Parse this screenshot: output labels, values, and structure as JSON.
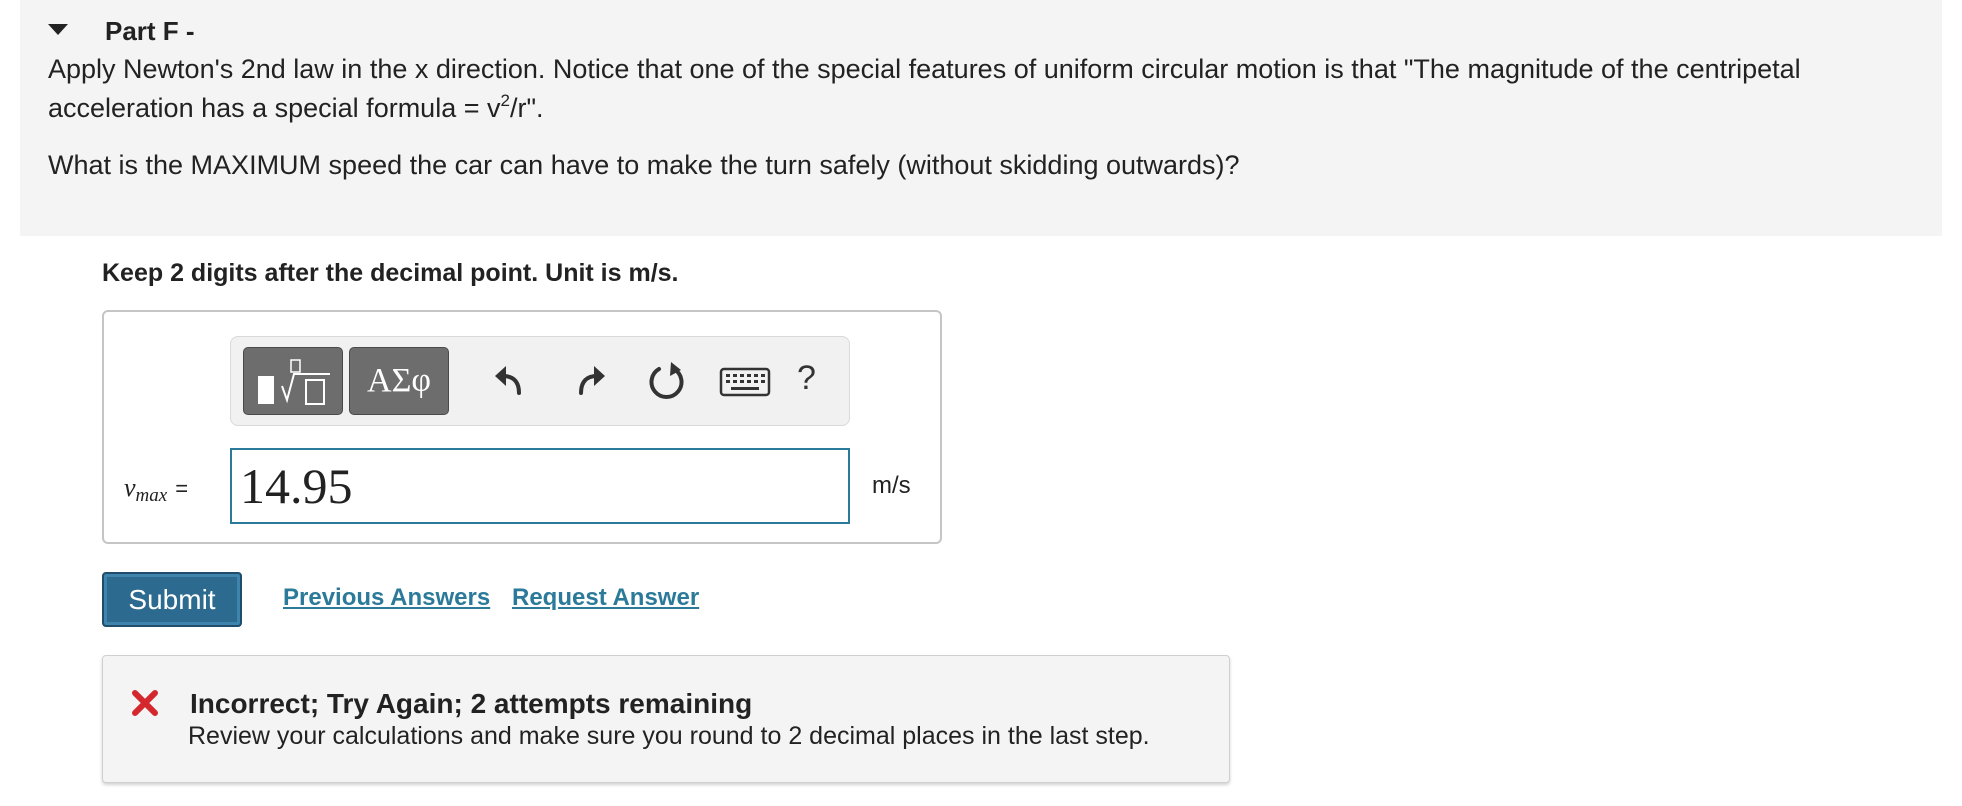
{
  "part": {
    "title": "Part F -",
    "question_line1": "Apply Newton's 2nd law in the x direction. Notice that one of the special features of uniform circular motion is that \"The magnitude of the centripetal acceleration has a special formula = v",
    "question_exp": "2",
    "question_tail": "/r\".",
    "question_line2": "What is the MAXIMUM speed the car can have to make the turn safely (without skidding outwards)?"
  },
  "answer": {
    "instruction": "Keep 2 digits after the decimal point. Unit is m/s.",
    "toolbar": {
      "symbols_label": "ΑΣφ",
      "help_label": "?",
      "icons": [
        "templates-icon",
        "undo-icon",
        "redo-icon",
        "reset-icon",
        "keyboard-icon",
        "help-icon"
      ]
    },
    "variable": "v",
    "variable_sub": "max",
    "equals": "=",
    "value": "14.95",
    "unit": "m/s"
  },
  "actions": {
    "submit_label": "Submit",
    "previous_answers": "Previous Answers",
    "request_answer": "Request Answer"
  },
  "feedback": {
    "title": "Incorrect; Try Again; 2 attempts remaining",
    "message": "Review your calculations and make sure you round to 2 decimal places in the last step.",
    "status_color": "#d4282e"
  },
  "colors": {
    "accent": "#2b7a99",
    "submit_bg": "#2d6a8f",
    "panel_bg": "#f4f4f4"
  }
}
